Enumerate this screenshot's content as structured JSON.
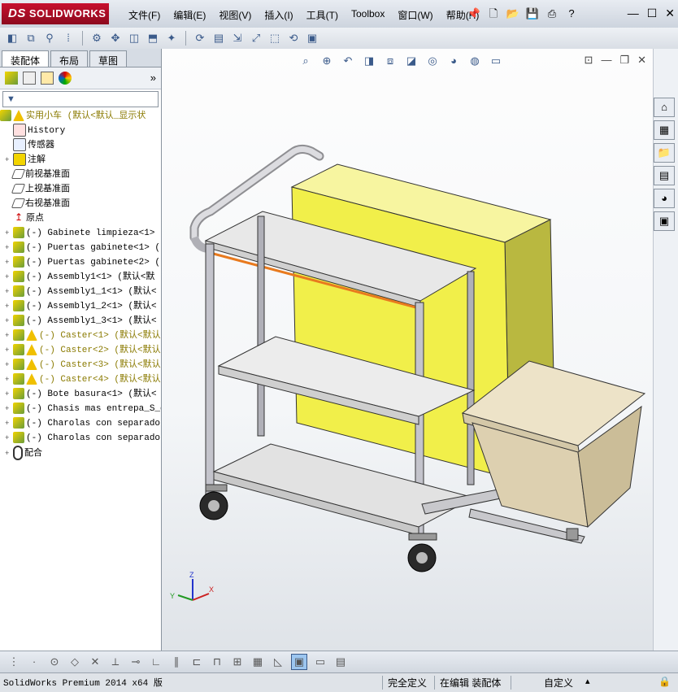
{
  "app": {
    "logo": "SOLIDWORKS",
    "logo_mark": "DS"
  },
  "menu": [
    "文件(F)",
    "编辑(E)",
    "视图(V)",
    "插入(I)",
    "工具(T)",
    "Toolbox",
    "窗口(W)",
    "帮助(H)"
  ],
  "tabs": [
    "装配体",
    "布局",
    "草图"
  ],
  "tree": {
    "root": "实用小车  (默认<默认_显示状",
    "items": [
      {
        "label": "History",
        "icon": "history-icon",
        "expander": ""
      },
      {
        "label": "传感器",
        "icon": "sensor-icon",
        "expander": ""
      },
      {
        "label": "注解",
        "icon": "annotation-icon",
        "expander": "+"
      },
      {
        "label": "前视基准面",
        "icon": "plane-icon",
        "expander": ""
      },
      {
        "label": "上视基准面",
        "icon": "plane-icon",
        "expander": ""
      },
      {
        "label": "右视基准面",
        "icon": "plane-icon",
        "expander": ""
      },
      {
        "label": "原点",
        "icon": "origin-icon",
        "expander": ""
      },
      {
        "label": "(-) Gabinete limpieza<1>",
        "icon": "part-icon",
        "expander": "+"
      },
      {
        "label": "(-) Puertas gabinete<1> (",
        "icon": "part-icon",
        "expander": "+"
      },
      {
        "label": "(-) Puertas gabinete<2> (",
        "icon": "part-icon",
        "expander": "+"
      },
      {
        "label": "(-) Assembly1<1> (默认<默",
        "icon": "part-icon",
        "expander": "+"
      },
      {
        "label": "(-) Assembly1_1<1> (默认<",
        "icon": "part-icon",
        "expander": "+"
      },
      {
        "label": "(-) Assembly1_2<1> (默认<",
        "icon": "part-icon",
        "expander": "+"
      },
      {
        "label": "(-) Assembly1_3<1> (默认<",
        "icon": "part-icon",
        "expander": "+"
      },
      {
        "label": "(-) Caster<1> (默认<默认",
        "icon": "warning-icon",
        "expander": "+",
        "warn": true
      },
      {
        "label": "(-) Caster<2> (默认<默认",
        "icon": "warning-icon",
        "expander": "+",
        "warn": true
      },
      {
        "label": "(-) Caster<3> (默认<默认",
        "icon": "warning-icon",
        "expander": "+",
        "warn": true
      },
      {
        "label": "(-) Caster<4> (默认<默认",
        "icon": "warning-icon",
        "expander": "+",
        "warn": true
      },
      {
        "label": "(-) Bote basura<1> (默认<",
        "icon": "part-icon",
        "expander": "+"
      },
      {
        "label": "(-) Chasis mas entrepa_S_c",
        "icon": "part-icon",
        "expander": "+"
      },
      {
        "label": "(-) Charolas con separador",
        "icon": "part-icon",
        "expander": "+"
      },
      {
        "label": "(-) Charolas con separador",
        "icon": "part-icon",
        "expander": "+"
      },
      {
        "label": "配合",
        "icon": "mate-icon",
        "expander": "+"
      }
    ]
  },
  "status": {
    "product": "SolidWorks Premium 2014 x64 版",
    "definition": "完全定义",
    "mode": "在编辑 装配体",
    "units": "自定义"
  },
  "colors": {
    "cabinet": "#f5f37a",
    "frame": "#c8c8d0",
    "shelf": "#e6e6e6",
    "bin": "#e0d4b8",
    "accent": "#e87a1e"
  }
}
